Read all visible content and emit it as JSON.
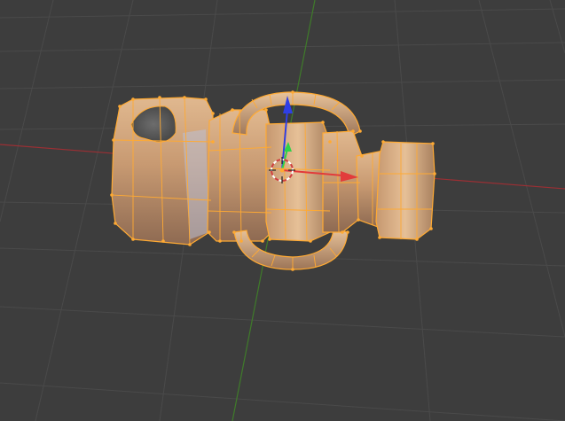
{
  "viewport": {
    "background": "#3d3d3d",
    "grid_color": "#4a4a4a",
    "x_axis_color": "#9b2f34",
    "y_axis_color": "#3f7b2a"
  },
  "object": {
    "fill": "#c89a72",
    "fill_light": "#e3bc93",
    "fill_shadow": "#8e6a52",
    "wire_color": "#ffaa33",
    "cool_highlight": "#b9bfd6"
  },
  "gizmo": {
    "x_color": "#e23b3b",
    "y_color": "#2fd24a",
    "z_color": "#2f3fe6",
    "cursor_ring": "#ffffff"
  }
}
